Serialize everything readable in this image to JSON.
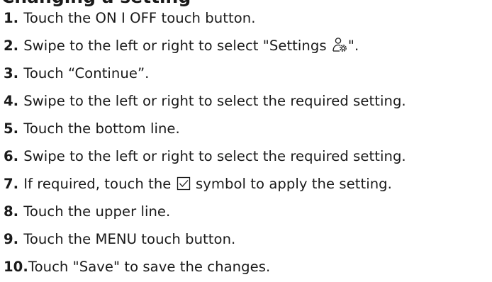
{
  "document": {
    "heading": "Changing a setting",
    "steps": [
      {
        "num": "1.",
        "text": "Touch the ON I OFF touch button."
      },
      {
        "num": "2.",
        "text_before": "Swipe to the left or right to select \"Settings ",
        "icon": "settings-person-gear-icon",
        "text_after": "\"."
      },
      {
        "num": "3.",
        "text": "Touch “Continue”."
      },
      {
        "num": "4.",
        "text": "Swipe to the left or right to select the required setting."
      },
      {
        "num": "5.",
        "text": "Touch the bottom line."
      },
      {
        "num": "6.",
        "text": "Swipe to the left or right to select the required setting."
      },
      {
        "num": "7.",
        "text_before": "If required, touch the ",
        "icon": "checkbox-check-icon",
        "text_after": " symbol to apply the setting."
      },
      {
        "num": "8.",
        "text": "Touch the upper line."
      },
      {
        "num": "9.",
        "text": "Touch the MENU touch button."
      },
      {
        "num": "10.",
        "text": "Touch \"Save\" to save the changes."
      }
    ]
  }
}
